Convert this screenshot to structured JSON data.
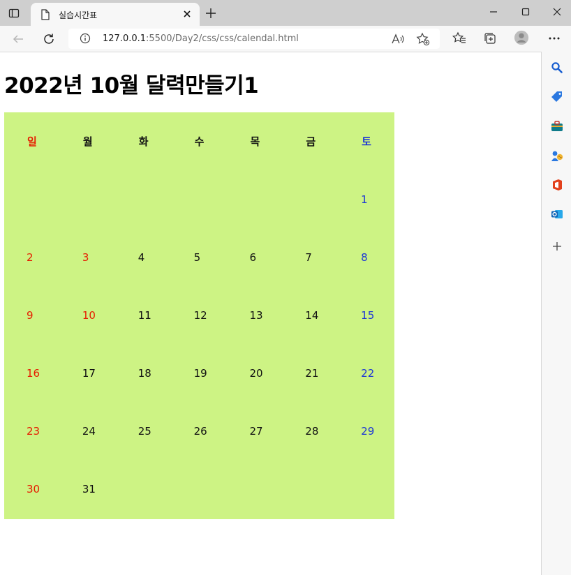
{
  "browser": {
    "tab_title": "실습시간표",
    "url_host": "127.0.0.1",
    "url_rest": ":5500/Day2/css/css/calendal.html"
  },
  "page": {
    "title": "2022년 10월 달력만들기1"
  },
  "calendar": {
    "background": "#cdf384",
    "sunday_color": "#e61c00",
    "saturday_color": "#1c36d6",
    "weekdays": [
      "일",
      "월",
      "화",
      "수",
      "목",
      "금",
      "토"
    ],
    "weeks": [
      [
        "",
        "",
        "",
        "",
        "",
        "",
        "1"
      ],
      [
        "2",
        "3",
        "4",
        "5",
        "6",
        "7",
        "8"
      ],
      [
        "9",
        "10",
        "11",
        "12",
        "13",
        "14",
        "15"
      ],
      [
        "16",
        "17",
        "18",
        "19",
        "20",
        "21",
        "22"
      ],
      [
        "23",
        "24",
        "25",
        "26",
        "27",
        "28",
        "29"
      ],
      [
        "30",
        "31",
        "",
        "",
        "",
        "",
        ""
      ]
    ],
    "red_days": [
      "2",
      "3",
      "9",
      "10",
      "16",
      "23",
      "30"
    ]
  }
}
